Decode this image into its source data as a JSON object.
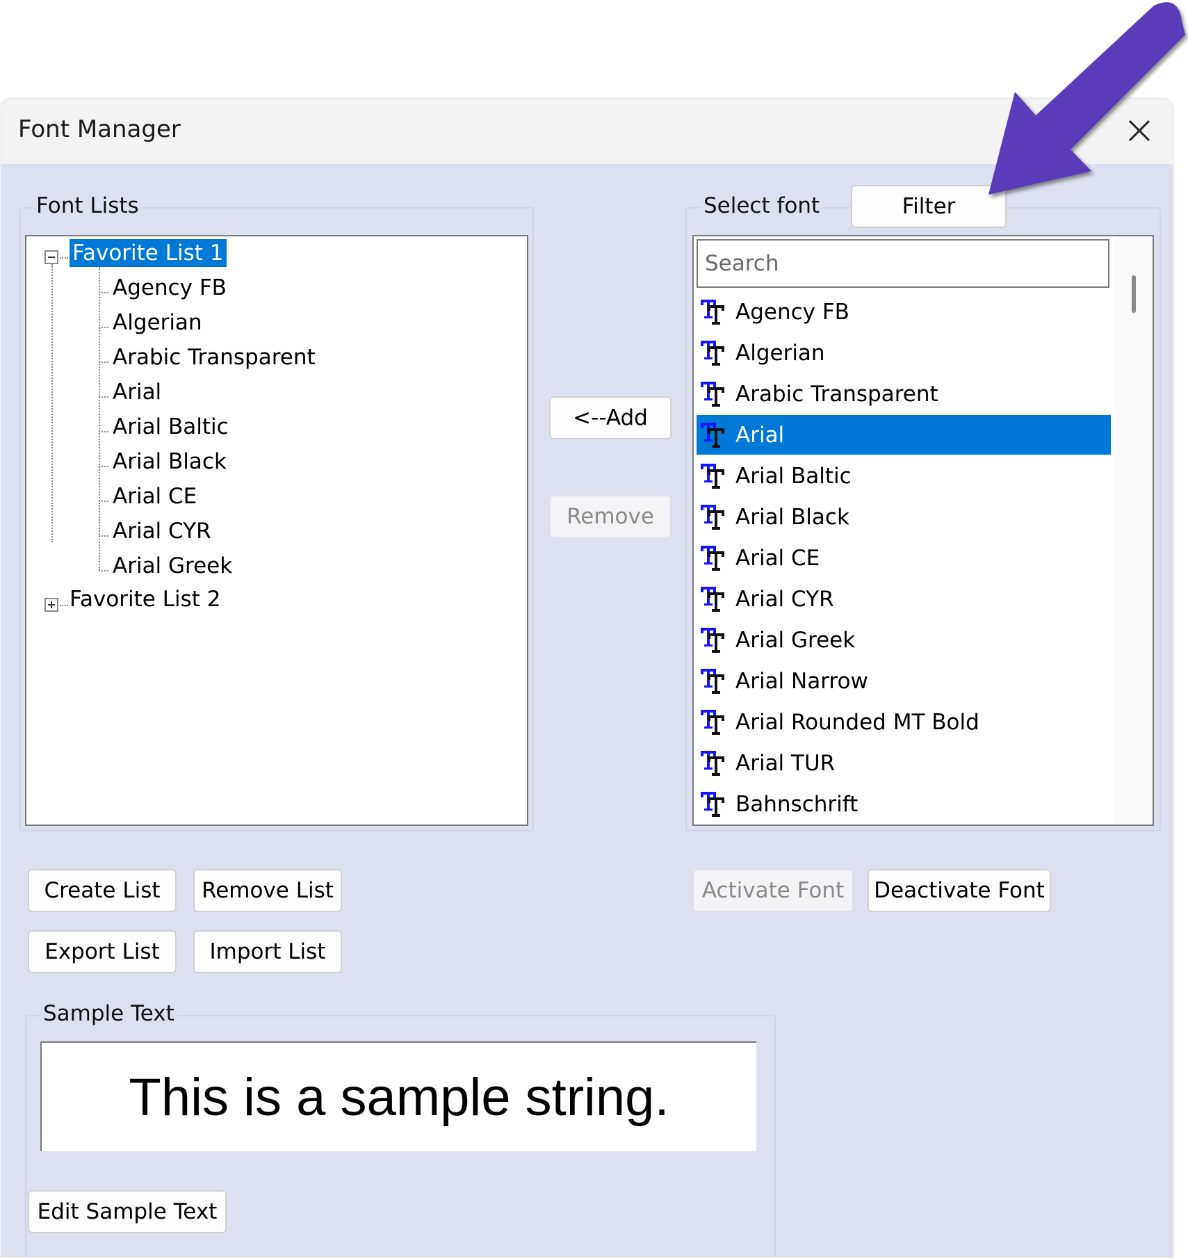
{
  "window": {
    "title": "Font Manager"
  },
  "font_lists": {
    "label": "Font Lists",
    "tree": [
      {
        "label": "Favorite List 1",
        "expanded": true,
        "selected": true,
        "children": [
          "Agency FB",
          "Algerian",
          "Arabic Transparent",
          "Arial",
          "Arial Baltic",
          "Arial Black",
          "Arial CE",
          "Arial CYR",
          "Arial Greek"
        ]
      },
      {
        "label": "Favorite List 2",
        "expanded": false,
        "selected": false,
        "children": []
      }
    ]
  },
  "middle": {
    "add_label": "<--Add",
    "remove_label": "Remove"
  },
  "select_font": {
    "label": "Select font",
    "filter_label": "Filter",
    "search_placeholder": "Search",
    "selected": "Arial",
    "items": [
      "Agency FB",
      "Algerian",
      "Arabic Transparent",
      "Arial",
      "Arial Baltic",
      "Arial Black",
      "Arial CE",
      "Arial CYR",
      "Arial Greek",
      "Arial Narrow",
      "Arial Rounded MT Bold",
      "Arial TUR",
      "Bahnschrift"
    ],
    "item_icon": "truetype-font-icon"
  },
  "list_buttons": {
    "create": "Create List",
    "remove": "Remove List",
    "export": "Export List",
    "import": "Import List"
  },
  "font_buttons": {
    "activate": "Activate Font",
    "deactivate": "Deactivate Font"
  },
  "sample": {
    "label": "Sample Text",
    "text": "This is a sample string.",
    "edit_label": "Edit Sample Text"
  },
  "annotation": {
    "icon": "arrow-pointer-icon",
    "color": "#5a3bb8"
  },
  "colors": {
    "selection": "#0078d7",
    "background": "#dde1ef"
  }
}
